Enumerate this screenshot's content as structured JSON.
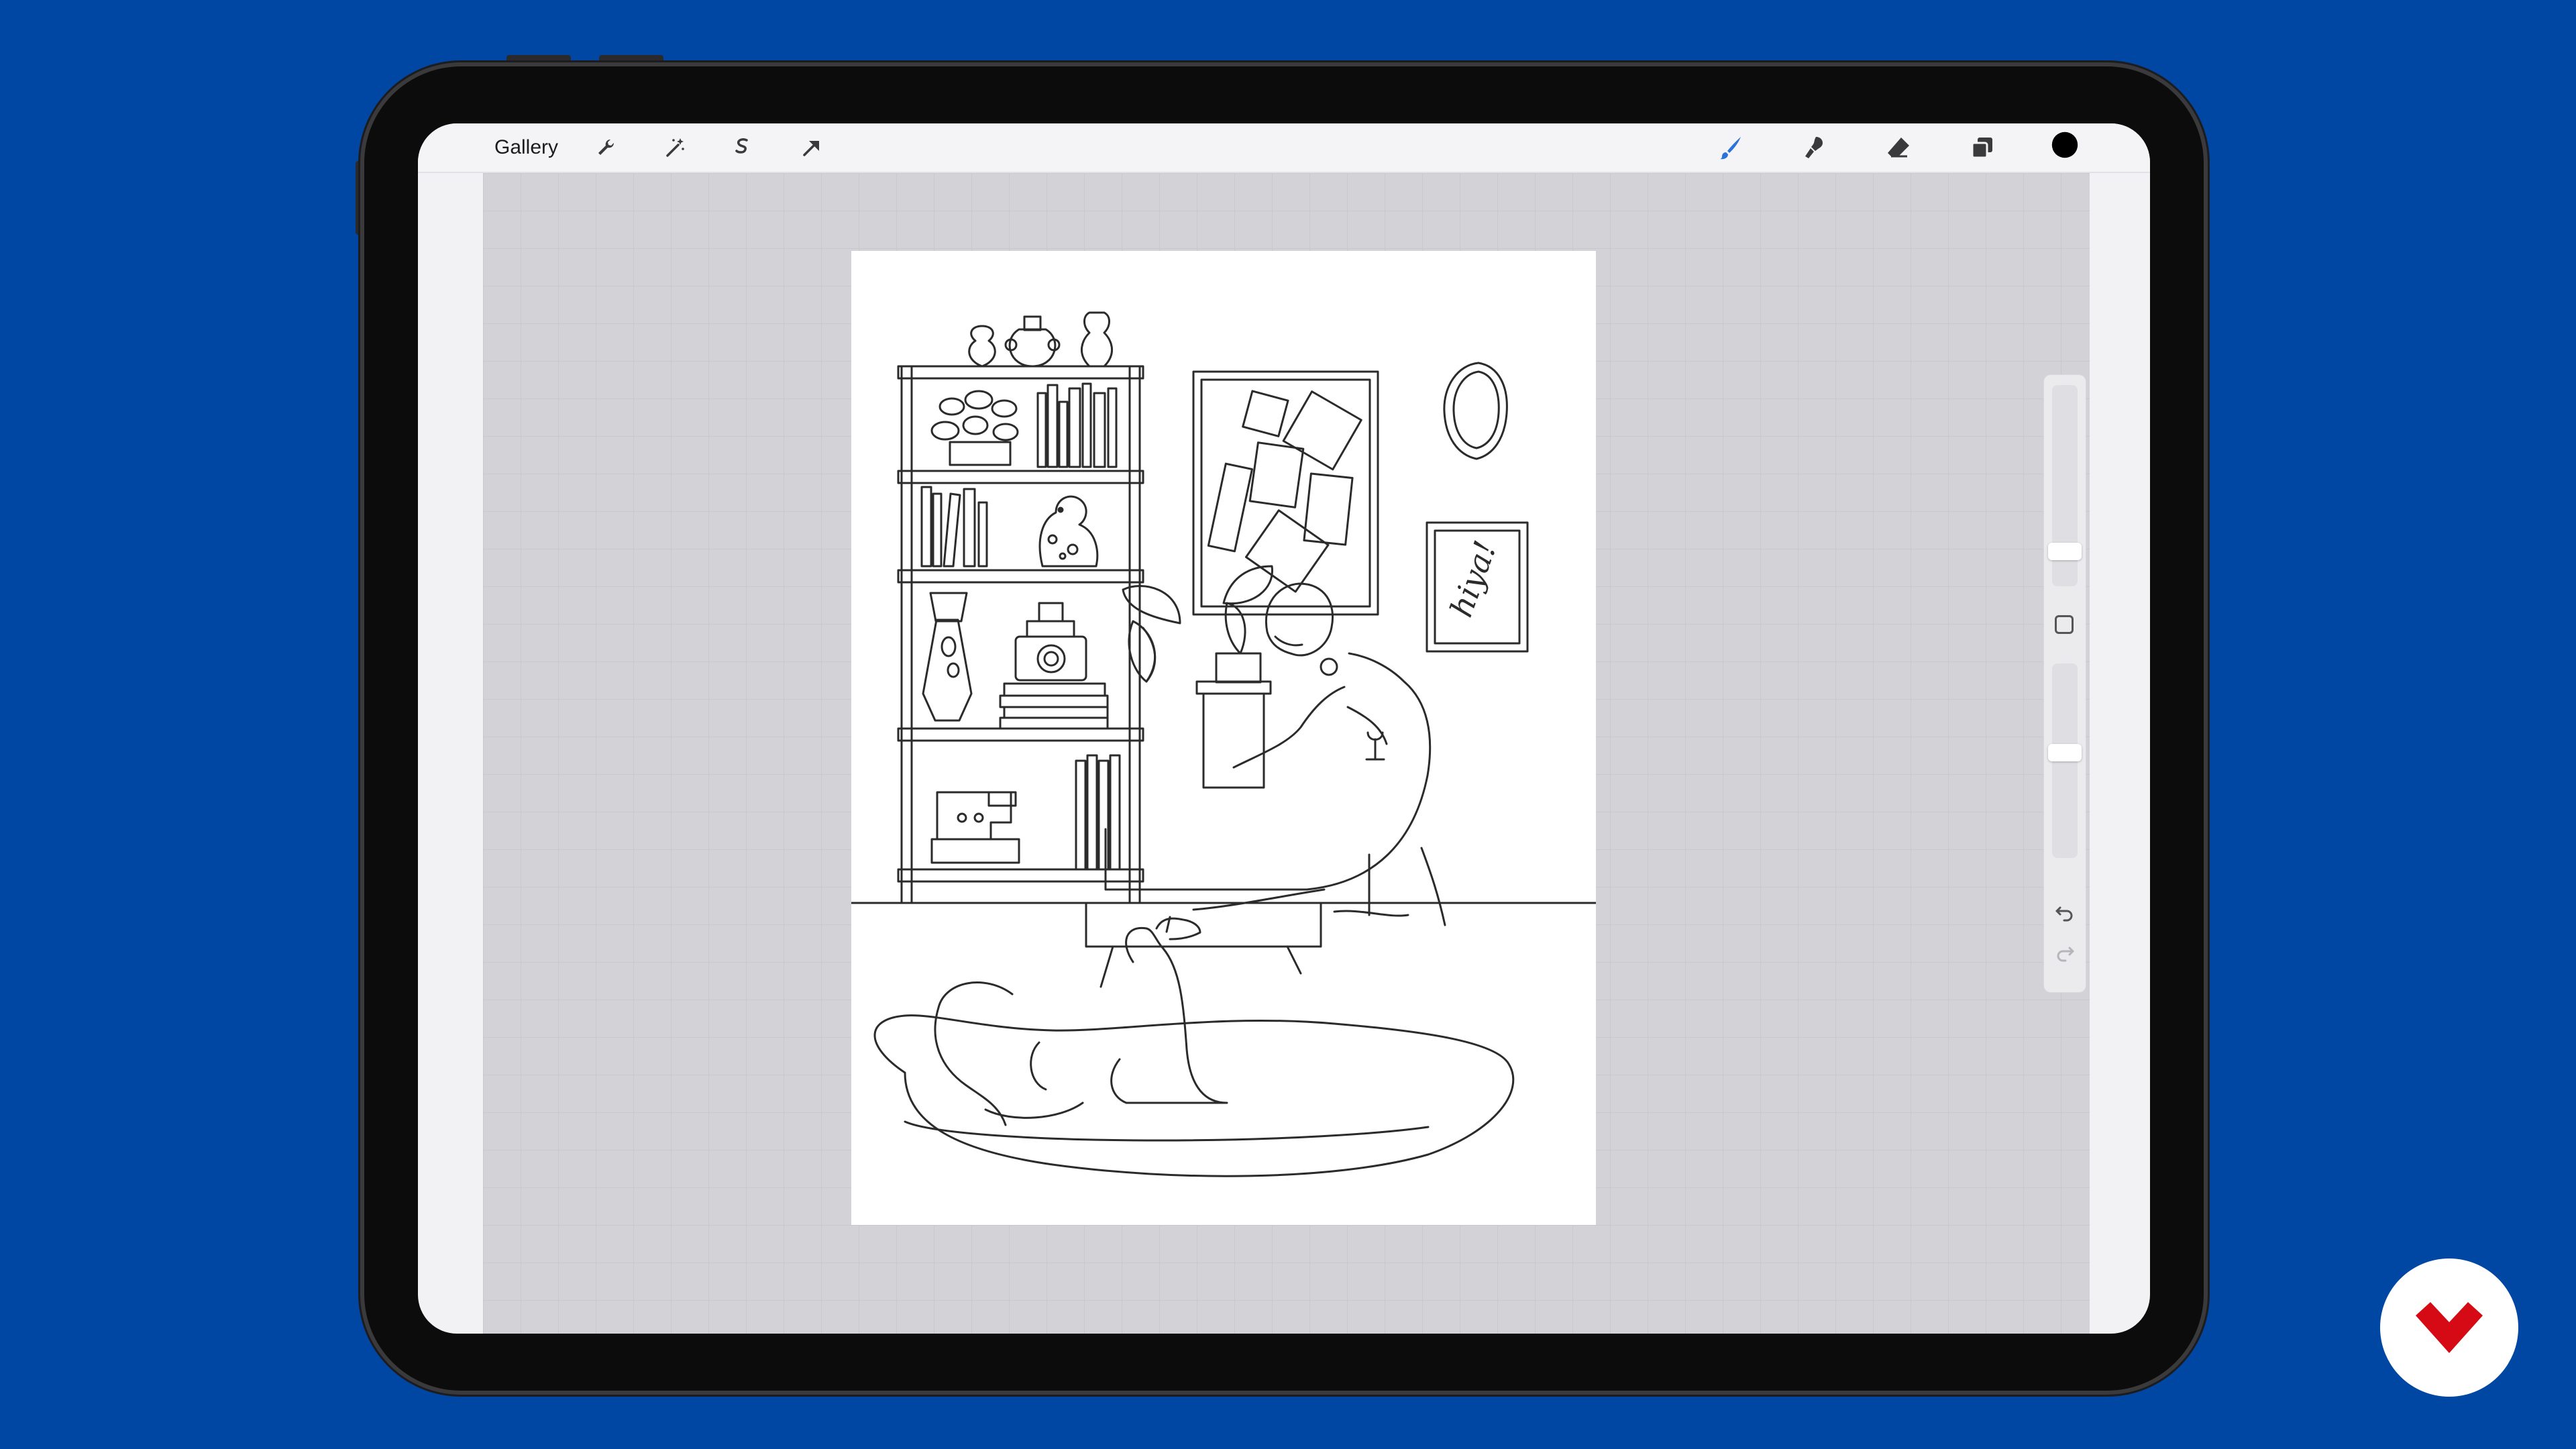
{
  "toolbar": {
    "gallery_label": "Gallery",
    "left_tools": [
      "wrench-icon",
      "magic-wand-icon",
      "selection-icon",
      "transform-arrow-icon"
    ],
    "right_tools": [
      "brush-icon",
      "smudge-icon",
      "eraser-icon",
      "layers-icon",
      "color-swatch"
    ],
    "active_tool": "brush-icon",
    "active_color": "#2a73d9",
    "current_color": "#000000"
  },
  "artwork": {
    "sign_text": "hiya!"
  },
  "sidebar": {
    "controls": [
      "brush-size-slider",
      "modify-button",
      "opacity-slider",
      "undo-button",
      "redo-button"
    ]
  },
  "colors": {
    "background": "#0047a3",
    "canvas": "#d3d3d7",
    "logo_mark": "#d60a14"
  }
}
